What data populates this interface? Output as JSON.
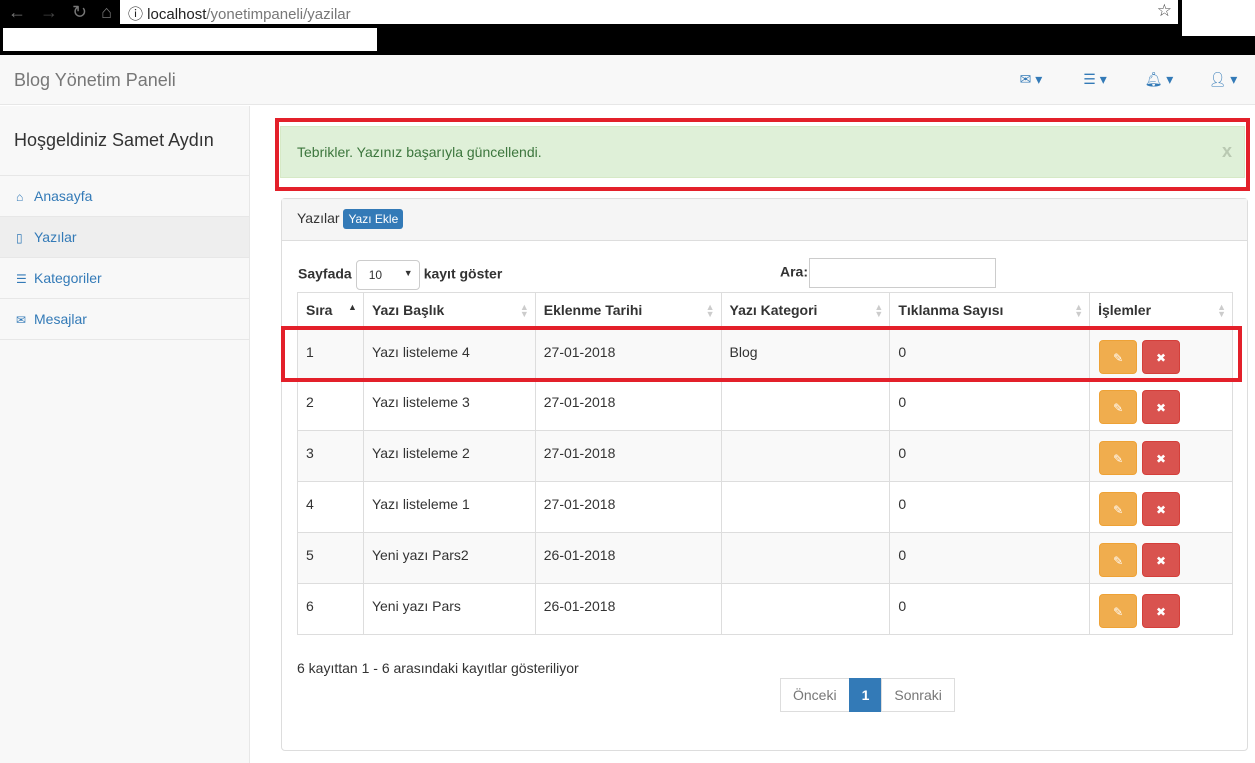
{
  "browser": {
    "url_host": "localhost",
    "url_path": "/yonetimpaneli/yazilar"
  },
  "navbar": {
    "brand": "Blog Yönetim Paneli"
  },
  "sidebar": {
    "welcome": "Hoşgeldiniz Samet Aydın",
    "items": [
      {
        "label": "Anasayfa",
        "icon": "home-icon"
      },
      {
        "label": "Yazılar",
        "icon": "file-icon"
      },
      {
        "label": "Kategoriler",
        "icon": "list-icon"
      },
      {
        "label": "Mesajlar",
        "icon": "envelope-icon"
      }
    ]
  },
  "alert": {
    "text": "Tebrikler. Yazınız başarıyla güncellendi.",
    "close": "x"
  },
  "panel": {
    "title": "Yazılar",
    "add_button": "Yazı Ekle"
  },
  "table_controls": {
    "length_prefix": "Sayfada",
    "length_value": "10",
    "length_suffix": "kayıt göster",
    "search_label": "Ara:",
    "search_value": ""
  },
  "table": {
    "headers": [
      "Sıra",
      "Yazı Başlık",
      "Eklenme Tarihi",
      "Yazı Kategori",
      "Tıklanma Sayısı",
      "İşlemler"
    ],
    "rows": [
      [
        "1",
        "Yazı listeleme 4",
        "27-01-2018",
        "Blog",
        "0"
      ],
      [
        "2",
        "Yazı listeleme 3",
        "27-01-2018",
        "",
        "0"
      ],
      [
        "3",
        "Yazı listeleme 2",
        "27-01-2018",
        "",
        "0"
      ],
      [
        "4",
        "Yazı listeleme 1",
        "27-01-2018",
        "",
        "0"
      ],
      [
        "5",
        "Yeni yazı Pars2",
        "26-01-2018",
        "",
        "0"
      ],
      [
        "6",
        "Yeni yazı Pars",
        "26-01-2018",
        "",
        "0"
      ]
    ]
  },
  "footer": {
    "info": "6 kayıttan 1 - 6 arasındaki kayıtlar gösteriliyor",
    "prev": "Önceki",
    "page": "1",
    "next": "Sonraki"
  }
}
